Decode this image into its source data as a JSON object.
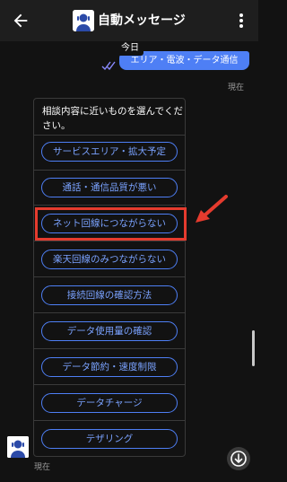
{
  "header": {
    "title": "自動メッセージ",
    "back_icon": "arrow-left-icon",
    "menu_icon": "kebab-menu-icon"
  },
  "conversation": {
    "date_chip": "今日",
    "sent_message": {
      "text": "エリア・電波・データ通信",
      "time": "現在"
    },
    "bot_message": {
      "prompt": "相談内容に近いものを選んでください。",
      "time": "現在",
      "options": [
        {
          "label": "サービスエリア・拡大予定"
        },
        {
          "label": "通話・通信品質が悪い"
        },
        {
          "label": "ネット回線につながらない"
        },
        {
          "label": "楽天回線のみつながらない"
        },
        {
          "label": "接続回線の確認方法"
        },
        {
          "label": "データ使用量の確認"
        },
        {
          "label": "データ節約・速度制限"
        },
        {
          "label": "データチャージ"
        },
        {
          "label": "テザリング"
        }
      ]
    }
  },
  "colors": {
    "background": "#121212",
    "app_bar": "#1e1e1e",
    "accent": "#4e7ff5",
    "highlight": "#e53b2e"
  }
}
